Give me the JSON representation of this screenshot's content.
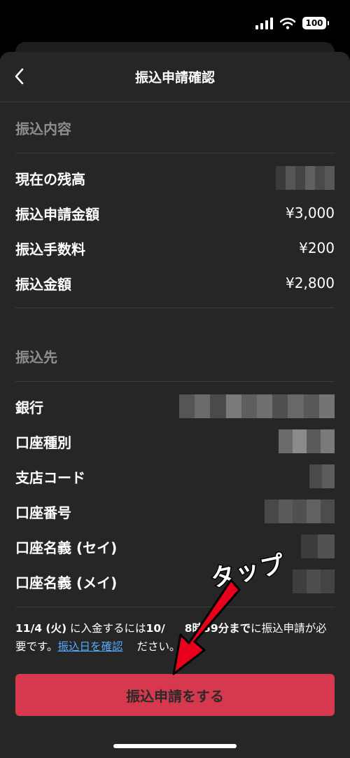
{
  "status_bar": {
    "battery": "100"
  },
  "nav": {
    "title": "振込申請確認"
  },
  "transfer_details": {
    "section_title": "振込内容",
    "rows": [
      {
        "label": "現在の残高",
        "value": ""
      },
      {
        "label": "振込申請金額",
        "value": "¥3,000"
      },
      {
        "label": "振込手数料",
        "value": "¥200"
      },
      {
        "label": "振込金額",
        "value": "¥2,800"
      }
    ]
  },
  "destination": {
    "section_title": "振込先",
    "rows": [
      {
        "label": "銀行"
      },
      {
        "label": "口座種別"
      },
      {
        "label": "支店コード"
      },
      {
        "label": "口座番号"
      },
      {
        "label": "口座名義 (セイ)"
      },
      {
        "label": "口座名義 (メイ)"
      }
    ]
  },
  "notice": {
    "date": "11/4 (火)",
    "text_a": " に入金するには",
    "deadline": "10/",
    "deadline_tail": "8時59分まで",
    "text_b": "に振込申請が必要です。",
    "link": "振込日を確認",
    "text_c": "ださい。"
  },
  "submit": {
    "label": "振込申請をする"
  },
  "annotation": {
    "text": "タップ"
  },
  "colors": {
    "accent": "#d6394d",
    "link": "#56a9ff",
    "sheet": "#262626"
  }
}
